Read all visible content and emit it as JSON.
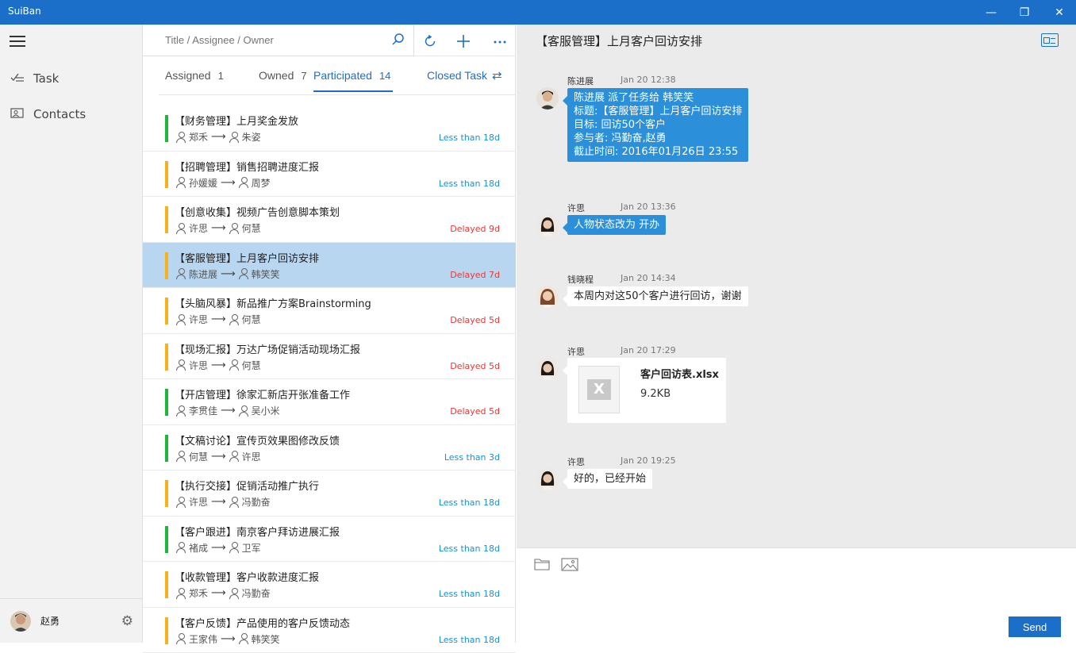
{
  "window": {
    "title": "SuiBan",
    "minimize": "—",
    "maximize": "❐",
    "close": "✕"
  },
  "nav": {
    "items": [
      {
        "label": "Task",
        "icon": "task-check-icon"
      },
      {
        "label": "Contacts",
        "icon": "contacts-card-icon"
      }
    ],
    "user": {
      "name": "赵勇"
    }
  },
  "search": {
    "placeholder": "Title / Assignee / Owner",
    "value": ""
  },
  "tabs": [
    {
      "label": "Assigned",
      "count": "1"
    },
    {
      "label": "Owned",
      "count": "7"
    },
    {
      "label": "Participated",
      "count": "14"
    }
  ],
  "closed_task_label": "Closed Task",
  "colors": {
    "accent": "#1b6fc9",
    "green": "#1fb53b",
    "orange": "#f5b21a",
    "status_blue": "#1b8fd6",
    "status_red": "#e53935",
    "selected": "#b8d6f0"
  },
  "tasks": [
    {
      "title": "【财务管理】上月奖金发放",
      "from": "郑禾",
      "to": "朱姿",
      "status": "Less than 18d",
      "status_type": "normal",
      "bar": "green"
    },
    {
      "title": "【招聘管理】销售招聘进度汇报",
      "from": "孙媛媛",
      "to": "周梦",
      "status": "Less than 18d",
      "status_type": "normal",
      "bar": "orange"
    },
    {
      "title": "【创意收集】视频广告创意脚本策划",
      "from": "许思",
      "to": "何慧",
      "status": "Delayed 9d",
      "status_type": "delayed",
      "bar": "orange"
    },
    {
      "title": "【客服管理】上月客户回访安排",
      "from": "陈进展",
      "to": "韩笑笑",
      "status": "Delayed 7d",
      "status_type": "delayed",
      "bar": "orange",
      "selected": true
    },
    {
      "title": "【头脑风暴】新品推广方案Brainstorming",
      "from": "许思",
      "to": "何慧",
      "status": "Delayed 5d",
      "status_type": "delayed",
      "bar": "orange"
    },
    {
      "title": "【现场汇报】万达广场促销活动现场汇报",
      "from": "许思",
      "to": "何慧",
      "status": "Delayed 5d",
      "status_type": "delayed",
      "bar": "orange"
    },
    {
      "title": "【开店管理】徐家汇新店开张准备工作",
      "from": "李贯佳",
      "to": "吴小米",
      "status": "Delayed 5d",
      "status_type": "delayed",
      "bar": "green"
    },
    {
      "title": "【文稿讨论】宣传页效果图修改反馈",
      "from": "何慧",
      "to": "许思",
      "status": "Less than 3d",
      "status_type": "normal",
      "bar": "green"
    },
    {
      "title": "【执行交接】促销活动推广执行",
      "from": "许思",
      "to": "冯勤奋",
      "status": "Less than 18d",
      "status_type": "normal",
      "bar": "orange"
    },
    {
      "title": "【客户跟进】南京客户拜访进展汇报",
      "from": "褚成",
      "to": "卫军",
      "status": "Less than 18d",
      "status_type": "normal",
      "bar": "green"
    },
    {
      "title": "【收款管理】客户收款进度汇报",
      "from": "郑禾",
      "to": "冯勤奋",
      "status": "Less than 18d",
      "status_type": "normal",
      "bar": "orange"
    },
    {
      "title": "【客户反馈】产品使用的客户反馈动态",
      "from": "王家伟",
      "to": "韩笑笑",
      "status": "Less than 18d",
      "status_type": "normal",
      "bar": "orange"
    }
  ],
  "chat": {
    "title": "【客服管理】上月客户回访安排",
    "messages": [
      {
        "sender": "陈进展",
        "time": "Jan 20  12:38",
        "style": "blue",
        "lines": [
          "陈进展 派了任务给 韩笑笑",
          "标题:【客服管理】上月客户回访安排",
          "目标: 回访50个客户",
          "参与者: 冯勤奋,赵勇",
          "截止时间: 2016年01月26日 23:55"
        ]
      },
      {
        "sender": "许思",
        "time": "Jan 20  13:36",
        "style": "blue",
        "lines": [
          "人物状态改为 开办"
        ]
      },
      {
        "sender": "钱晓程",
        "time": "Jan 20  14:34",
        "style": "white",
        "lines": [
          "本周内对这50个客户进行回访，谢谢"
        ]
      },
      {
        "sender": "许思",
        "time": "Jan 20  17:29",
        "style": "file",
        "file_name": "客户回访表.xlsx",
        "file_size": "9.2KB"
      },
      {
        "sender": "许思",
        "time": "Jan 20  19:25",
        "style": "white",
        "lines": [
          "好的，已经开始"
        ]
      }
    ],
    "send_label": "Send"
  }
}
